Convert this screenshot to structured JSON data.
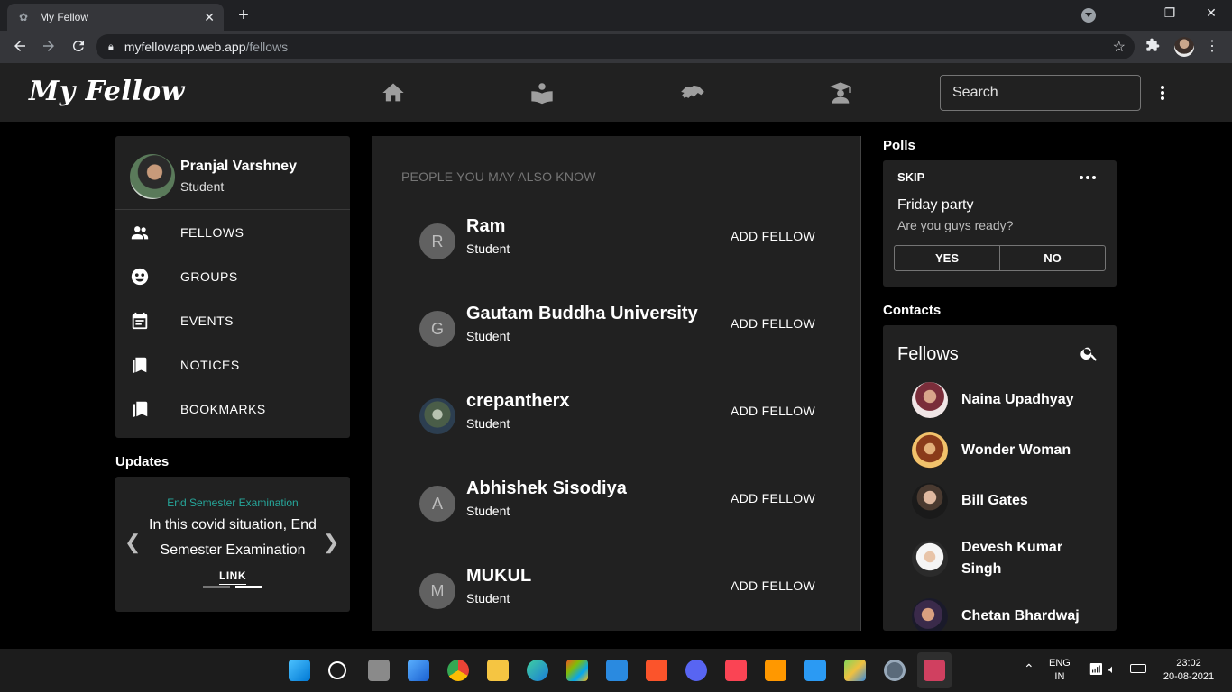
{
  "browser": {
    "tab_title": "My Fellow",
    "tab_close": "✕",
    "new_tab": "+",
    "url_host": "myfellowapp.web.app",
    "url_path": "/fellows",
    "back_icon": "arrow-left-icon",
    "forward_icon": "arrow-right-icon",
    "reload_icon": "reload-icon"
  },
  "app": {
    "logo": "My Fellow",
    "nav": [
      "home-icon",
      "learn-icon",
      "handshake-icon",
      "graduate-icon"
    ],
    "search_placeholder": "Search"
  },
  "profile": {
    "name": "Pranjal Varshney",
    "role": "Student"
  },
  "sidebar": {
    "items": [
      {
        "label": "FELLOWS",
        "icon": "people-icon"
      },
      {
        "label": "GROUPS",
        "icon": "groups-icon"
      },
      {
        "label": "EVENTS",
        "icon": "events-icon"
      },
      {
        "label": "NOTICES",
        "icon": "notices-icon"
      },
      {
        "label": "BOOKMARKS",
        "icon": "bookmarks-icon"
      }
    ]
  },
  "updates": {
    "heading": "Updates",
    "title": "End Semester Examination",
    "body": "In this covid situation, End Semester Examination",
    "link": "LINK",
    "prev": "❮",
    "next": "❯"
  },
  "people": {
    "heading": "PEOPLE YOU MAY ALSO KNOW",
    "add_label": "ADD FELLOW",
    "list": [
      {
        "initial": "R",
        "name": "Ram",
        "role": "Student"
      },
      {
        "initial": "G",
        "name": "Gautam Buddha University",
        "role": "Student"
      },
      {
        "initial": "",
        "name": "crepantherx",
        "role": "Student"
      },
      {
        "initial": "A",
        "name": "Abhishek Sisodiya",
        "role": "Student"
      },
      {
        "initial": "M",
        "name": "MUKUL",
        "role": "Student"
      }
    ]
  },
  "polls": {
    "heading": "Polls",
    "skip": "SKIP",
    "question": "Friday party",
    "subtitle": "Are you guys ready?",
    "yes": "YES",
    "no": "NO"
  },
  "contacts": {
    "heading": "Contacts",
    "title": "Fellows",
    "list": [
      {
        "name": "Naina Upadhyay"
      },
      {
        "name": "Wonder Woman"
      },
      {
        "name": "Bill Gates"
      },
      {
        "name": "Devesh Kumar Singh"
      },
      {
        "name": "Chetan Bhardwaj"
      }
    ]
  },
  "taskbar": {
    "lang_top": "ENG",
    "lang_bottom": "IN",
    "time": "23:02",
    "date": "20-08-2021"
  }
}
